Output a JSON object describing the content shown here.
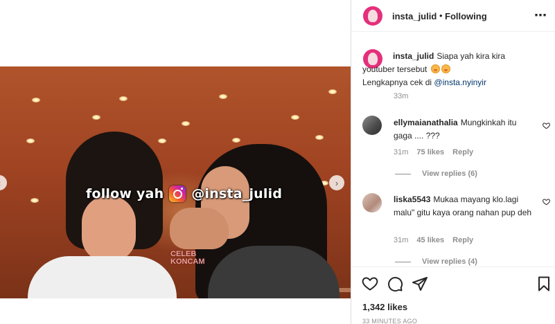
{
  "header": {
    "username": "insta_julid",
    "separator": "•",
    "follow_status": "Following",
    "more_icon": "⋯"
  },
  "media": {
    "overlay_text_prefix": "follow yah",
    "overlay_handle": "@insta_julid",
    "watermark_line1": "CELEB",
    "watermark_line2": "KONCAM",
    "nav_prev_icon": "‹",
    "nav_next_icon": "›"
  },
  "caption": {
    "username": "insta_julid",
    "text": "Siapa yah kira kira youtuber tersebut",
    "line2_prefix": "Lengkapnya cek di",
    "mention": "@insta.nyinyir",
    "time": "33m"
  },
  "comments": [
    {
      "username": "ellymaianathalia",
      "text": "Mungkinkah itu gaga .... ???",
      "time": "31m",
      "likes": "75 likes",
      "reply_label": "Reply",
      "view_replies": "View replies (6)"
    },
    {
      "username": "liska5543",
      "text": "Mukaa mayang klo.lagi malu\" gitu kaya orang nahan pup deh",
      "time": "31m",
      "likes": "45 likes",
      "reply_label": "Reply",
      "view_replies": "View replies (4)"
    }
  ],
  "footer": {
    "likes": "1,342 likes",
    "time_ago": "33 MINUTES AGO"
  },
  "icons": [
    "more-icon",
    "heart-icon",
    "comment-icon",
    "share-icon",
    "bookmark-icon",
    "chevron-left-icon",
    "chevron-right-icon",
    "instagram-logo-icon"
  ],
  "colors": {
    "avatar_bg": "#e4307b",
    "link": "#00376b",
    "muted": "#8e8e8e",
    "text": "#262626"
  }
}
